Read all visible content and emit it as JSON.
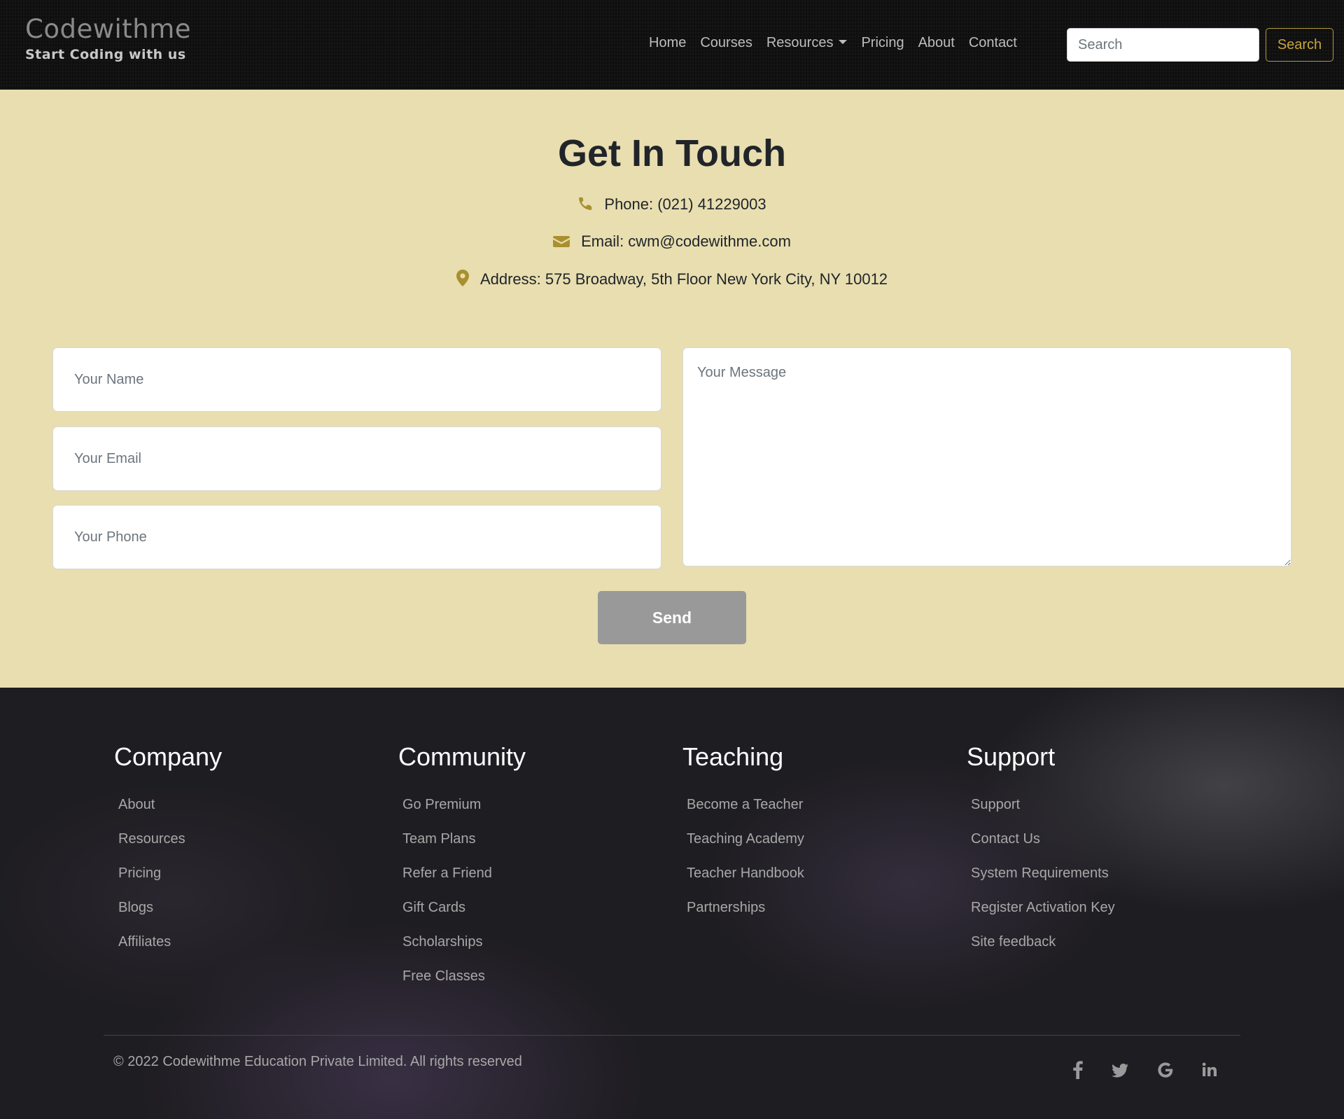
{
  "brand": {
    "name": "Codewithme",
    "tagline": "Start Coding with us"
  },
  "nav": {
    "links": [
      "Home",
      "Courses",
      "Resources",
      "Pricing",
      "About",
      "Contact"
    ],
    "search_placeholder": "Search",
    "search_button": "Search"
  },
  "contact": {
    "title": "Get In Touch",
    "phone": "Phone: (021) 41229003",
    "email": "Email: cwm@codewithme.com",
    "address": "Address: 575 Broadway, 5th Floor New York City, NY 10012",
    "accent_color": "#a8902e"
  },
  "form": {
    "name_placeholder": "Your Name",
    "email_placeholder": "Your Email",
    "phone_placeholder": "Your Phone",
    "message_placeholder": "Your Message",
    "send_label": "Send"
  },
  "footer": {
    "columns": [
      {
        "title": "Company",
        "links": [
          "About",
          "Resources",
          "Pricing",
          "Blogs",
          "Affiliates"
        ]
      },
      {
        "title": "Community",
        "links": [
          "Go Premium",
          "Team Plans",
          "Refer a Friend",
          "Gift Cards",
          "Scholarships",
          "Free Classes"
        ]
      },
      {
        "title": "Teaching",
        "links": [
          "Become a Teacher",
          "Teaching Academy",
          "Teacher Handbook",
          "Partnerships"
        ]
      },
      {
        "title": "Support",
        "links": [
          "Support",
          "Contact Us",
          "System Requirements",
          "Register Activation Key",
          "Site feedback"
        ]
      }
    ],
    "copyright": "© 2022 Codewithme Education Private Limited. All rights reserved",
    "social_icons": [
      "facebook-icon",
      "twitter-icon",
      "google-icon",
      "linkedin-icon"
    ]
  }
}
